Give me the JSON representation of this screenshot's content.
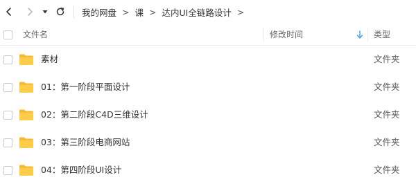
{
  "toolbar": {
    "back_icon": "chevron-left-icon",
    "forward_icon": "chevron-right-icon",
    "dropdown_icon": "caret-down-icon",
    "refresh_icon": "refresh-icon"
  },
  "breadcrumb": {
    "items": [
      "我的网盘",
      "课",
      "达内UI全链路设计"
    ],
    "separator": ">"
  },
  "header": {
    "name_label": "文件名",
    "time_label": "修改时间",
    "type_label": "类型",
    "sort_icon": "sort-arrow-down-icon",
    "sort_color": "#3b9cf5"
  },
  "colors": {
    "folder": "#ffcc47",
    "folder_tab": "#f5b82e"
  },
  "rows": [
    {
      "name": "素材",
      "type": "文件夹",
      "time": ""
    },
    {
      "name": "01：第一阶段平面设计",
      "type": "文件夹",
      "time": ""
    },
    {
      "name": "02：第二阶段C4D三维设计",
      "type": "文件夹",
      "time": ""
    },
    {
      "name": "03：第三阶段电商网站",
      "type": "文件夹",
      "time": ""
    },
    {
      "name": "04：第四阶段UI设计",
      "type": "文件夹",
      "time": ""
    }
  ]
}
